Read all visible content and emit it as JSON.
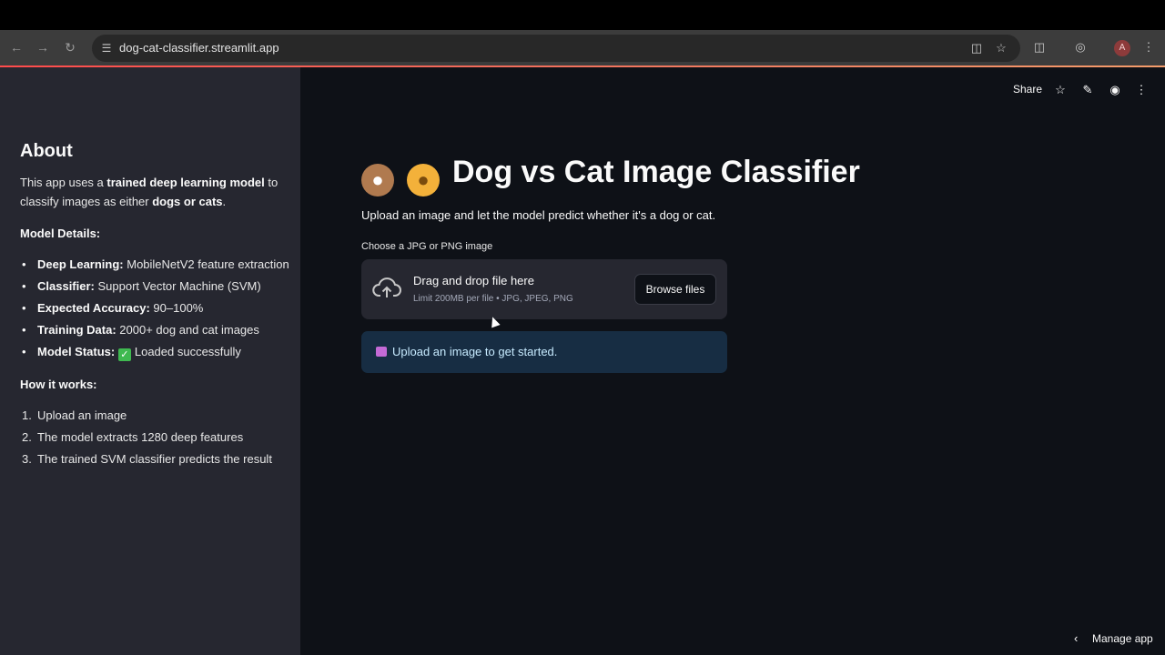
{
  "browser": {
    "url": "dog-cat-classifier.streamlit.app",
    "profile_initial": "A",
    "icons": [
      "back-icon",
      "forward-icon",
      "reload-icon",
      "site-info-icon",
      "install-icon",
      "bookmark-star-icon",
      "extensions-icon",
      "lens-icon",
      "profile-avatar",
      "menu-icon"
    ]
  },
  "sidebar": {
    "heading": "About",
    "intro": {
      "t1": "This app uses a ",
      "b1": "trained deep learning model",
      "t2": " to classify images as either ",
      "b2": "dogs or cats",
      "t3": "."
    },
    "model_details_heading": "Model Details:",
    "model_details": [
      {
        "label": "Deep Learning:",
        "value": " MobileNetV2 feature extraction"
      },
      {
        "label": "Classifier:",
        "value": " Support Vector Machine (SVM)"
      },
      {
        "label": "Expected Accuracy:",
        "value": " 90–100%"
      },
      {
        "label": "Training Data:",
        "value": " 2000+ dog and cat images"
      },
      {
        "label": "Model Status:",
        "value": "Loaded successfully"
      }
    ],
    "how_heading": "How it works:",
    "how_steps": [
      {
        "num": "1.",
        "text": "Upload an image"
      },
      {
        "num": "2.",
        "text": "The model extracts 1280 deep features"
      },
      {
        "num": "3.",
        "text": "The trained SVM classifier predicts the result"
      }
    ]
  },
  "header": {
    "share": "Share"
  },
  "main": {
    "title": "Dog vs Cat Image Classifier",
    "subtitle": "Upload an image and let the model predict whether it's a dog or cat.",
    "uploader_label": "Choose a JPG or PNG image",
    "dropzone_title": "Drag and drop file here",
    "dropzone_limit": "Limit 200MB per file • JPG, JPEG, PNG",
    "browse_label": "Browse files",
    "info_text": "Upload an image to get started.",
    "manage_app": "Manage app"
  },
  "colors": {
    "sidebar_bg": "#262730",
    "main_bg": "#0e1117",
    "info_bg": "#172d43",
    "accent": "#ff4b4b"
  }
}
